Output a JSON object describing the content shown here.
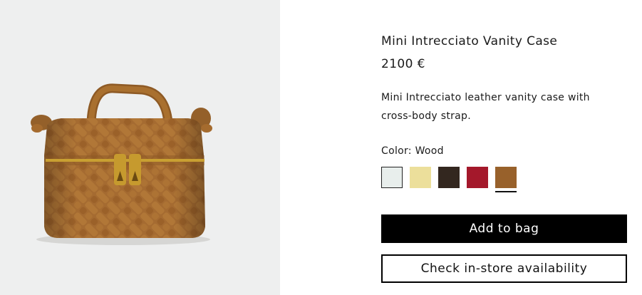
{
  "product": {
    "name": "Mini Intrecciato Vanity Case",
    "price": "2100 €",
    "description": "Mini Intrecciato leather vanity case with cross-body strap.",
    "image_alt_icon": "handbag-icon"
  },
  "color": {
    "label": "Color:",
    "selected": "Wood",
    "swatches": [
      {
        "color": "#e8eeec",
        "selected": false
      },
      {
        "color": "#ecdf9b",
        "selected": false
      },
      {
        "color": "#33271f",
        "selected": false
      },
      {
        "color": "#a4182b",
        "selected": false
      },
      {
        "color": "#98612b",
        "selected": true
      }
    ]
  },
  "actions": {
    "add_to_bag": "Add to bag",
    "check_store": "Check in-store availability"
  },
  "colors": {
    "image_bg": "#eeefef",
    "leather": "#a2692f",
    "hardware": "#c9a032",
    "button_bg": "#000000"
  }
}
